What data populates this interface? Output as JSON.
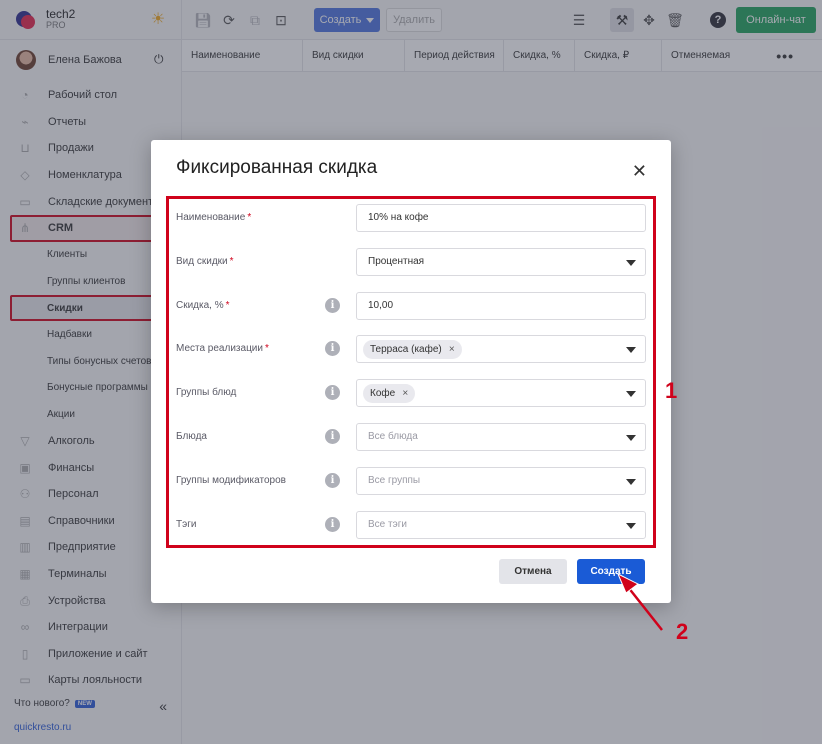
{
  "brand": {
    "name": "tech2",
    "plan": "PRO"
  },
  "user": {
    "name": "Елена Бажова"
  },
  "sidebar": {
    "items": [
      {
        "label": "Рабочий стол",
        "icon": "speedometer-icon"
      },
      {
        "label": "Отчеты",
        "icon": "chart-icon"
      },
      {
        "label": "Продажи",
        "icon": "basket-icon"
      },
      {
        "label": "Номенклатура",
        "icon": "tag-icon"
      },
      {
        "label": "Складские документы",
        "icon": "document-icon"
      },
      {
        "label": "CRM",
        "icon": "crm-icon"
      }
    ],
    "crm_sub": [
      "Клиенты",
      "Группы клиентов",
      "Скидки",
      "Надбавки",
      "Типы бонусных счетов",
      "Бонусные программы",
      "Акции"
    ],
    "items2": [
      {
        "label": "Алкоголь",
        "icon": "glass-icon"
      },
      {
        "label": "Финансы",
        "icon": "wallet-icon"
      },
      {
        "label": "Персонал",
        "icon": "people-icon"
      },
      {
        "label": "Справочники",
        "icon": "book-icon"
      },
      {
        "label": "Предприятие",
        "icon": "building-icon"
      },
      {
        "label": "Терминалы",
        "icon": "terminal-icon"
      },
      {
        "label": "Устройства",
        "icon": "printer-icon"
      },
      {
        "label": "Интеграции",
        "icon": "link-icon"
      },
      {
        "label": "Приложение и сайт",
        "icon": "phone-icon"
      },
      {
        "label": "Карты лояльности",
        "icon": "card-icon"
      }
    ],
    "whatsnew": "Что нового?",
    "new_badge": "NEW",
    "site": "quickresto.ru"
  },
  "toolbar": {
    "create_label": "Создать",
    "delete_label": "Удалить",
    "chat_label": "Онлайн-чат"
  },
  "table": {
    "columns": [
      "Наименование",
      "Вид скидки",
      "Период действия",
      "Скидка, %",
      "Скидка, ₽",
      "Отменяемая"
    ]
  },
  "modal": {
    "title": "Фиксированная скидка",
    "fields": [
      {
        "label": "Наименование",
        "required": true,
        "info": false,
        "value": "10% на кофе",
        "type": "text"
      },
      {
        "label": "Вид скидки",
        "required": true,
        "info": false,
        "value": "Процентная",
        "type": "select"
      },
      {
        "label": "Скидка, %",
        "required": true,
        "info": true,
        "value": "10,00",
        "type": "text"
      },
      {
        "label": "Места реализации",
        "required": true,
        "info": true,
        "chip": "Терраса (кафе)",
        "type": "multiselect"
      },
      {
        "label": "Группы блюд",
        "required": false,
        "info": true,
        "chip": "Кофе",
        "type": "multiselect"
      },
      {
        "label": "Блюда",
        "required": false,
        "info": true,
        "placeholder": "Все блюда",
        "type": "select"
      },
      {
        "label": "Группы модификаторов",
        "required": false,
        "info": true,
        "placeholder": "Все группы",
        "type": "select"
      },
      {
        "label": "Тэги",
        "required": false,
        "info": true,
        "placeholder": "Все тэги",
        "type": "select"
      }
    ],
    "cancel_label": "Отмена",
    "create_label": "Создать"
  },
  "annotations": {
    "callout1": "1",
    "callout2": "2",
    "color": "#d0021b"
  }
}
